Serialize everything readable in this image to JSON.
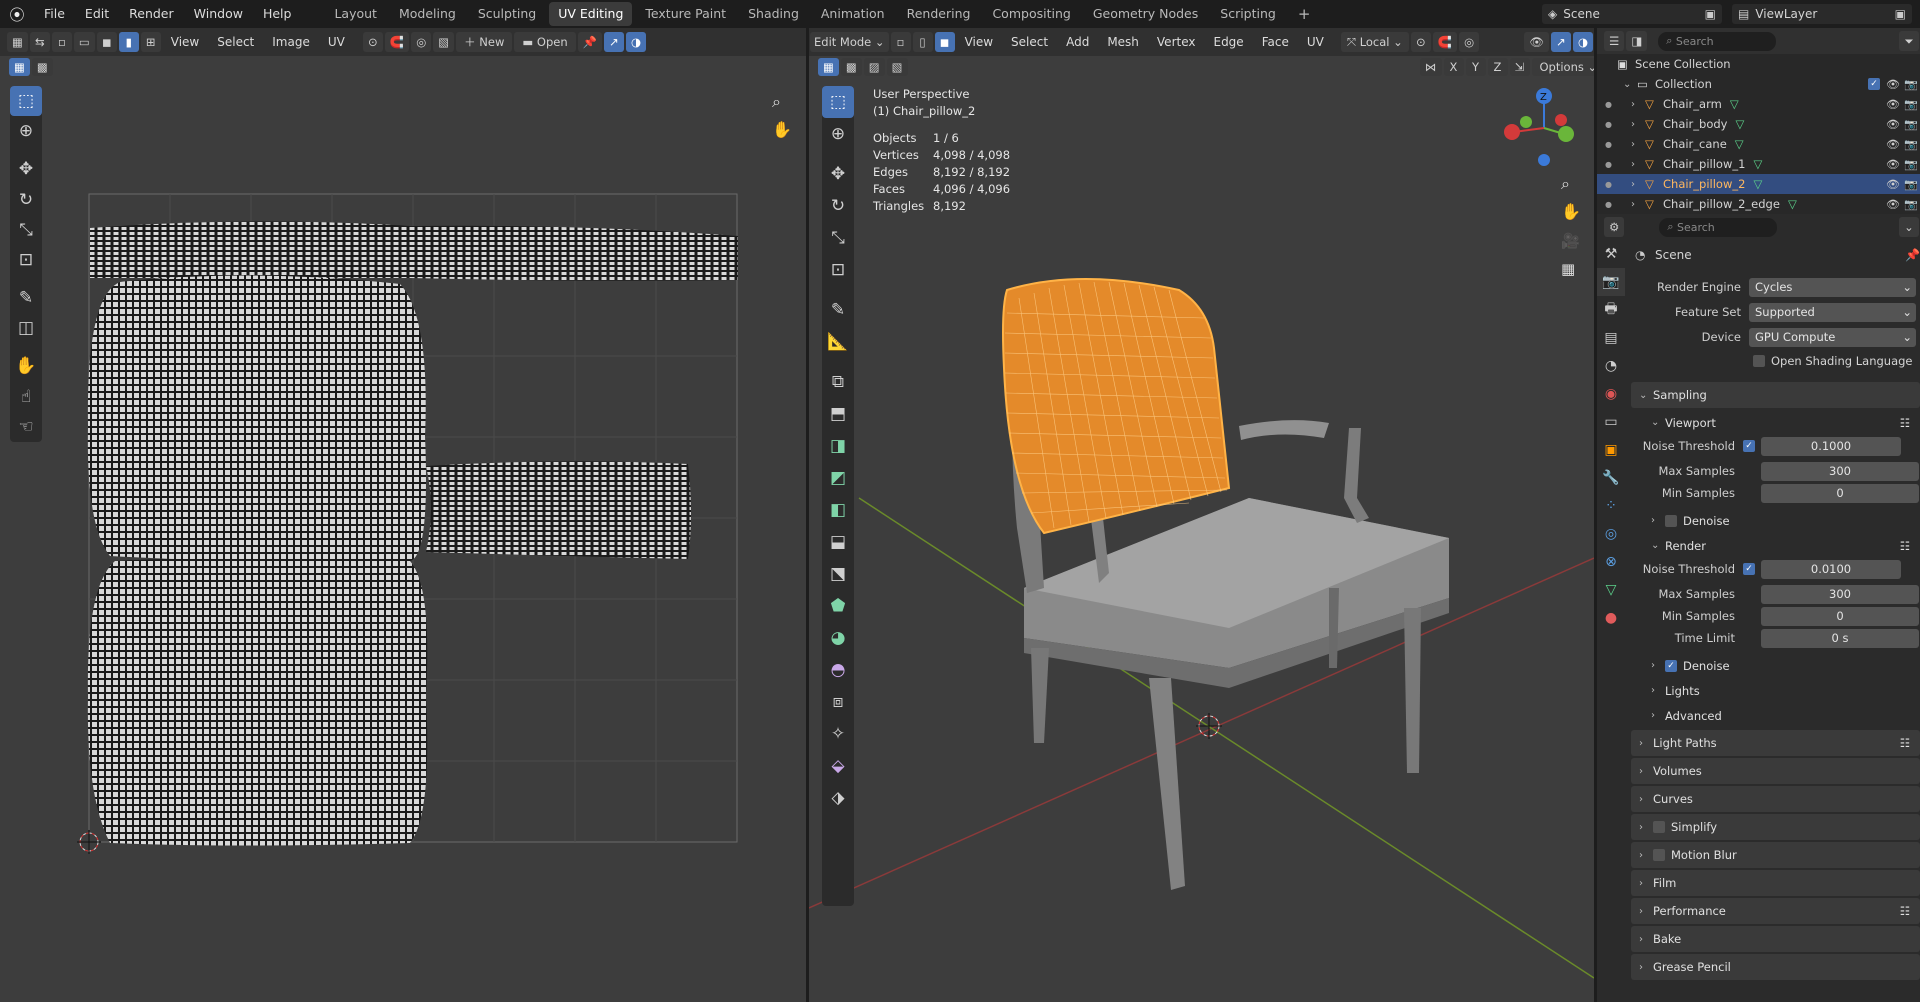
{
  "topbar": {
    "menus": [
      "File",
      "Edit",
      "Render",
      "Window",
      "Help"
    ],
    "workspaces": [
      "Layout",
      "Modeling",
      "Sculpting",
      "UV Editing",
      "Texture Paint",
      "Shading",
      "Animation",
      "Rendering",
      "Compositing",
      "Geometry Nodes",
      "Scripting"
    ],
    "active_workspace": "UV Editing",
    "add": "+",
    "scene": "Scene",
    "viewlayer": "ViewLayer"
  },
  "uv": {
    "menus": [
      "View",
      "Select",
      "Image",
      "UV"
    ],
    "new": "New",
    "open": "Open"
  },
  "vp": {
    "mode": "Edit Mode",
    "menus": [
      "View",
      "Select",
      "Add",
      "Mesh",
      "Vertex",
      "Edge",
      "Face",
      "UV"
    ],
    "orientation": "Local",
    "axes": [
      "X",
      "Y",
      "Z"
    ],
    "options": "Options",
    "title": "User Perspective",
    "object": "(1) Chair_pillow_2",
    "stats": [
      {
        "k": "Objects",
        "v": "1 / 6"
      },
      {
        "k": "Vertices",
        "v": "4,098 / 4,098"
      },
      {
        "k": "Edges",
        "v": "8,192 / 8,192"
      },
      {
        "k": "Faces",
        "v": "4,096 / 4,096"
      },
      {
        "k": "Triangles",
        "v": "8,192"
      }
    ],
    "gizmo": {
      "z": "Z",
      "x": "X",
      "y": "Y"
    }
  },
  "outliner": {
    "search": "Search",
    "root": "Scene Collection",
    "collection": "Collection",
    "items": [
      "Chair_arm",
      "Chair_body",
      "Chair_cane",
      "Chair_pillow_1",
      "Chair_pillow_2",
      "Chair_pillow_2_edge"
    ],
    "selected": "Chair_pillow_2"
  },
  "props": {
    "search": "Search",
    "context": "Scene",
    "rows": [
      {
        "k": "Render Engine",
        "v": "Cycles"
      },
      {
        "k": "Feature Set",
        "v": "Supported"
      },
      {
        "k": "Device",
        "v": "GPU Compute"
      }
    ],
    "osl": "Open Shading Language",
    "sampling": "Sampling",
    "viewport": "Viewport",
    "render": "Render",
    "vp_rows": [
      {
        "k": "Noise Threshold",
        "v": "0.1000",
        "chk": true
      },
      {
        "k": "Max Samples",
        "v": "300"
      },
      {
        "k": "Min Samples",
        "v": "0"
      }
    ],
    "denoise": "Denoise",
    "r_rows": [
      {
        "k": "Noise Threshold",
        "v": "0.0100",
        "chk": true
      },
      {
        "k": "Max Samples",
        "v": "300"
      },
      {
        "k": "Min Samples",
        "v": "0"
      },
      {
        "k": "Time Limit",
        "v": "0 s"
      }
    ],
    "lights": "Lights",
    "advanced": "Advanced",
    "sections": [
      "Light Paths",
      "Volumes",
      "Curves",
      "Simplify",
      "Motion Blur",
      "Film",
      "Performance",
      "Bake",
      "Grease Pencil"
    ]
  },
  "colors": {
    "accent": "#4772b3",
    "selection": "#ff9a2e",
    "bg": "#3d3d3d",
    "header": "#303030"
  }
}
